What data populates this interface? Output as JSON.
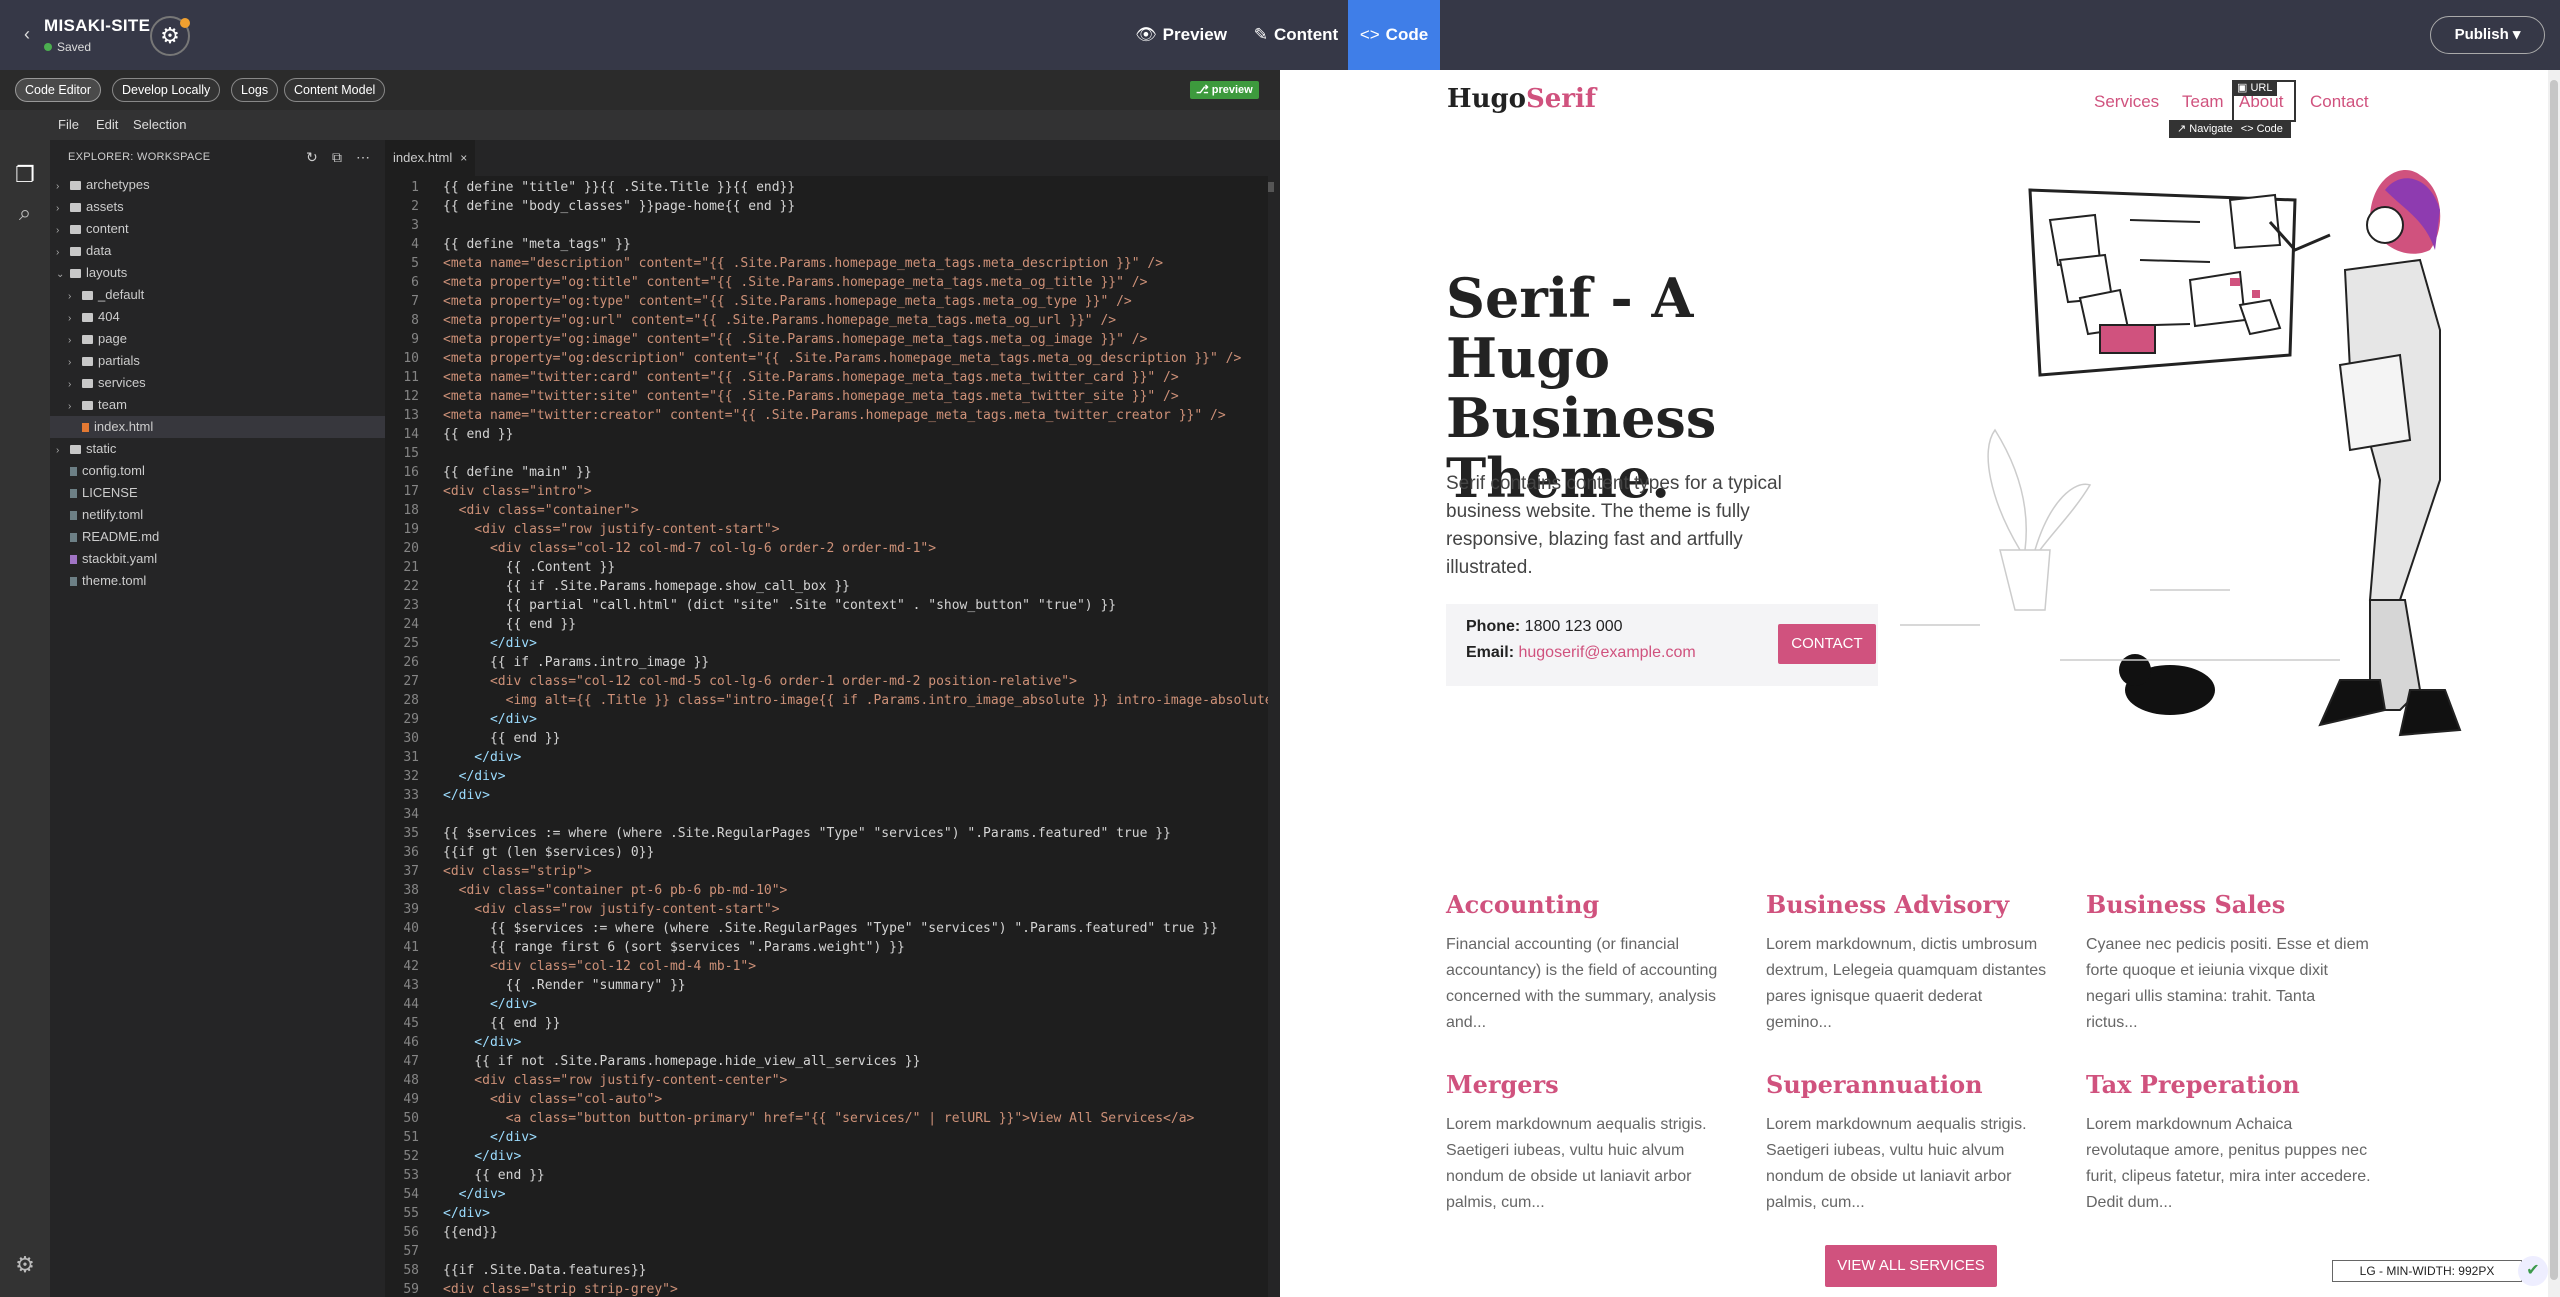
{
  "topbar": {
    "back_icon": "chevron-left-icon",
    "site_name": "MISAKI-SITE",
    "saved_status": "Saved",
    "settings_icon": "gear-icon",
    "tabs": [
      {
        "label": "Preview",
        "icon": "eye-icon"
      },
      {
        "label": "Content",
        "icon": "pencil-icon"
      },
      {
        "label": "Code",
        "icon": "code-icon",
        "active": true
      }
    ],
    "publish_label": "Publish ▾",
    "accent_color": "#3f7ee8"
  },
  "toolbar": {
    "buttons": [
      "Code Editor",
      "Develop Locally",
      "Logs",
      "Content Model"
    ],
    "preview_badge": "preview"
  },
  "menubar": [
    "File",
    "Edit",
    "Selection"
  ],
  "explorer": {
    "title": "EXPLORER: WORKSPACE",
    "tree": [
      {
        "label": "archetypes",
        "type": "folder",
        "expanded": false
      },
      {
        "label": "assets",
        "type": "folder",
        "expanded": false
      },
      {
        "label": "content",
        "type": "folder",
        "expanded": false
      },
      {
        "label": "data",
        "type": "folder",
        "expanded": false
      },
      {
        "label": "layouts",
        "type": "folder",
        "expanded": true
      },
      {
        "label": "_default",
        "type": "folder",
        "expanded": false
      },
      {
        "label": "404",
        "type": "folder",
        "expanded": false
      },
      {
        "label": "page",
        "type": "folder",
        "expanded": false
      },
      {
        "label": "partials",
        "type": "folder",
        "expanded": false
      },
      {
        "label": "services",
        "type": "folder",
        "expanded": false
      },
      {
        "label": "team",
        "type": "folder",
        "expanded": false
      },
      {
        "label": "index.html",
        "type": "file",
        "selected": true
      },
      {
        "label": "static",
        "type": "folder",
        "expanded": false
      },
      {
        "label": "config.toml",
        "type": "file"
      },
      {
        "label": "LICENSE",
        "type": "file"
      },
      {
        "label": "netlify.toml",
        "type": "file"
      },
      {
        "label": "README.md",
        "type": "file"
      },
      {
        "label": "stackbit.yaml",
        "type": "file"
      },
      {
        "label": "theme.toml",
        "type": "file"
      }
    ]
  },
  "editor": {
    "tab_label": "index.html",
    "lines": [
      "{{ define \"title\" }}{{ .Site.Title }}{{ end}}",
      "{{ define \"body_classes\" }}page-home{{ end }}",
      "",
      "{{ define \"meta_tags\" }}",
      "<meta name=\"description\" content=\"{{ .Site.Params.homepage_meta_tags.meta_description }}\" />",
      "<meta property=\"og:title\" content=\"{{ .Site.Params.homepage_meta_tags.meta_og_title }}\" />",
      "<meta property=\"og:type\" content=\"{{ .Site.Params.homepage_meta_tags.meta_og_type }}\" />",
      "<meta property=\"og:url\" content=\"{{ .Site.Params.homepage_meta_tags.meta_og_url }}\" />",
      "<meta property=\"og:image\" content=\"{{ .Site.Params.homepage_meta_tags.meta_og_image }}\" />",
      "<meta property=\"og:description\" content=\"{{ .Site.Params.homepage_meta_tags.meta_og_description }}\" />",
      "<meta name=\"twitter:card\" content=\"{{ .Site.Params.homepage_meta_tags.meta_twitter_card }}\" />",
      "<meta name=\"twitter:site\" content=\"{{ .Site.Params.homepage_meta_tags.meta_twitter_site }}\" />",
      "<meta name=\"twitter:creator\" content=\"{{ .Site.Params.homepage_meta_tags.meta_twitter_creator }}\" />",
      "{{ end }}",
      "",
      "{{ define \"main\" }}",
      "<div class=\"intro\">",
      "  <div class=\"container\">",
      "    <div class=\"row justify-content-start\">",
      "      <div class=\"col-12 col-md-7 col-lg-6 order-2 order-md-1\">",
      "        {{ .Content }}",
      "        {{ if .Site.Params.homepage.show_call_box }}",
      "        {{ partial \"call.html\" (dict \"site\" .Site \"context\" . \"show_button\" \"true\") }}",
      "        {{ end }}",
      "      </div>",
      "      {{ if .Params.intro_image }}",
      "      <div class=\"col-12 col-md-5 col-lg-6 order-1 order-md-2 position-relative\">",
      "        <img alt={{ .Title }} class=\"intro-image{{ if .Params.intro_image_absolute }} intro-image-absolute{{ end }}\"",
      "      </div>",
      "      {{ end }}",
      "    </div>",
      "  </div>",
      "</div>",
      "",
      "{{ $services := where (where .Site.RegularPages \"Type\" \"services\") \".Params.featured\" true }}",
      "{{if gt (len $services) 0}}",
      "<div class=\"strip\">",
      "  <div class=\"container pt-6 pb-6 pb-md-10\">",
      "    <div class=\"row justify-content-start\">",
      "      {{ $services := where (where .Site.RegularPages \"Type\" \"services\") \".Params.featured\" true }}",
      "      {{ range first 6 (sort $services \".Params.weight\") }}",
      "      <div class=\"col-12 col-md-4 mb-1\">",
      "        {{ .Render \"summary\" }}",
      "      </div>",
      "      {{ end }}",
      "    </div>",
      "    {{ if not .Site.Params.homepage.hide_view_all_services }}",
      "    <div class=\"row justify-content-center\">",
      "      <div class=\"col-auto\">",
      "        <a class=\"button button-primary\" href=\"{{ \"services/\" | relURL }}\">View All Services</a>",
      "      </div>",
      "    </div>",
      "    {{ end }}",
      "  </div>",
      "</div>",
      "{{end}}",
      "",
      "{{if .Site.Data.features}}",
      "<div class=\"strip strip-grey\">"
    ]
  },
  "preview": {
    "logo_main": "Hugo",
    "logo_accent": "Serif",
    "nav": [
      "Services",
      "Team",
      "About",
      "Contact"
    ],
    "url_label": "URL",
    "navigate_label": "↗ Navigate",
    "code_label": "<> Code",
    "hero_title": "Serif - A Hugo Business Theme.",
    "hero_desc": "Serif contains content types for a typical business website. The theme is fully responsive, blazing fast and artfully illustrated.",
    "phone_label": "Phone:",
    "phone_value": "1800 123 000",
    "email_label": "Email:",
    "email_value": "hugoserif@example.com",
    "contact_button": "CONTACT",
    "services": [
      {
        "title": "Accounting",
        "desc": "Financial accounting (or financial accountancy) is the field of accounting concerned with the summary, analysis and..."
      },
      {
        "title": "Business Advisory",
        "desc": "Lorem markdownum, dictis umbrosum dextrum, Lelegeia quamquam distantes pares ignisque quaerit dederat gemino..."
      },
      {
        "title": "Business Sales",
        "desc": "Cyanee nec pedicis positi. Esse et diem forte quoque et ieiunia vixque dixit negari ullis stamina: trahit. Tanta rictus..."
      },
      {
        "title": "Mergers",
        "desc": "Lorem markdownum aequalis strigis. Saetigeri iubeas, vultu huic alvum nondum de obside ut laniavit arbor palmis, cum..."
      },
      {
        "title": "Superannuation",
        "desc": "Lorem markdownum aequalis strigis. Saetigeri iubeas, vultu huic alvum nondum de obside ut laniavit arbor palmis, cum..."
      },
      {
        "title": "Tax Preperation",
        "desc": "Lorem markdownum Achaica revolutaque amore, penitus puppes nec furit, clipeus fatetur, mira inter accedere. Dedit dum..."
      }
    ],
    "view_all": "VIEW ALL SERVICES",
    "breakpoint_badge": "LG - MIN-WIDTH: 992PX",
    "accent_color": "#d0527e"
  }
}
